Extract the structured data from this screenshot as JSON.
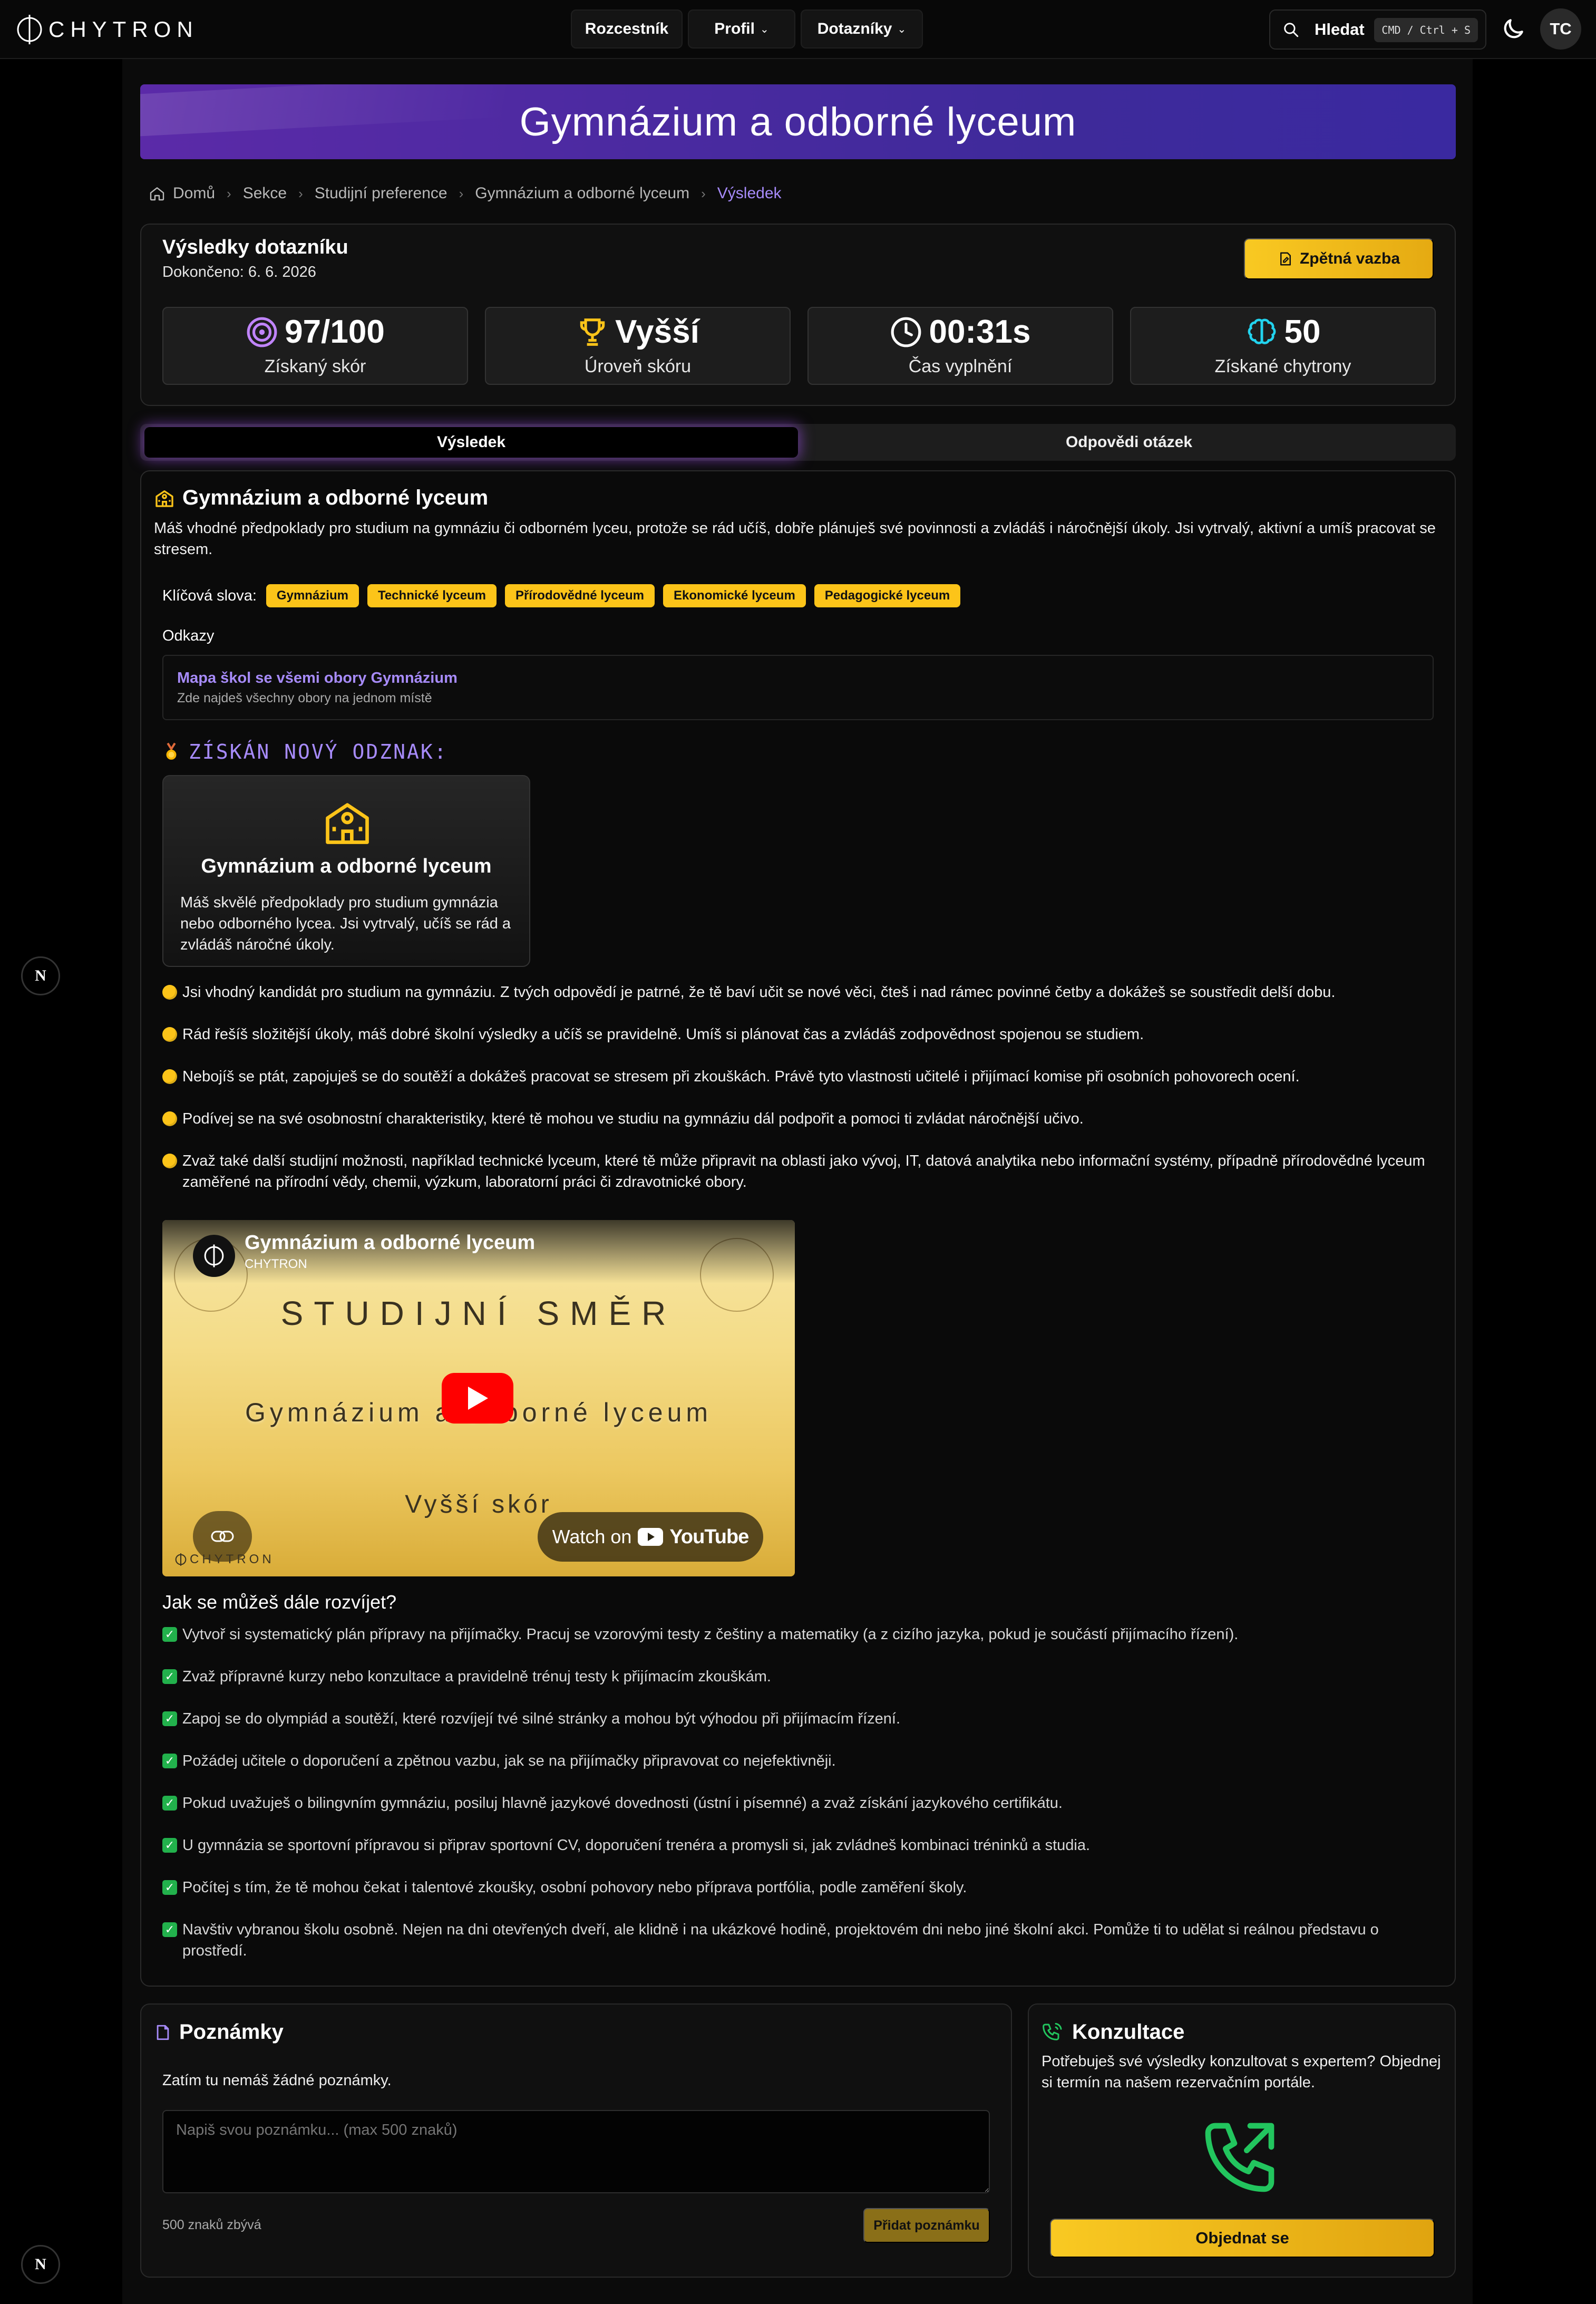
{
  "navbar": {
    "logo_text": "CHYTRON",
    "nav_items": [
      {
        "label": "Rozcestník",
        "has_dropdown": false
      },
      {
        "label": "Profil",
        "has_dropdown": true
      },
      {
        "label": "Dotazníky",
        "has_dropdown": true
      }
    ],
    "search_label": "Hledat",
    "search_shortcut": "CMD / Ctrl + S",
    "avatar_initials": "TC",
    "theme_icon": "moon-icon"
  },
  "hero": {
    "title": "Gymnázium a odborné lyceum"
  },
  "breadcrumb": [
    "Domů",
    "Sekce",
    "Studijní preference",
    "Gymnázium a odborné lyceum",
    "Výsledek"
  ],
  "result": {
    "title": "Výsledky dotazníku",
    "completed": "Dokončeno: 6. 6. 2026",
    "feedback_label": "Zpětná vazba",
    "stats": [
      {
        "value": "97/100",
        "label": "Získaný skór",
        "icon": "target-icon"
      },
      {
        "value": "Vyšší",
        "label": "Úroveň skóru",
        "icon": "trophy-icon"
      },
      {
        "value": "00:31s",
        "label": "Čas vyplnění",
        "icon": "clock-icon"
      },
      {
        "value": "50",
        "label": "Získané chytrony",
        "icon": "brain-icon"
      }
    ]
  },
  "tabs": [
    "Výsledek",
    "Odpovědi otázek"
  ],
  "content": {
    "title": "Gymnázium a odborné lyceum",
    "description": "Máš vhodné předpoklady pro studium na gymnáziu či odborném lyceu, protože se rád učíš, dobře plánuješ své povinnosti a zvládáš i náročnější úkoly. Jsi vytrvalý, aktivní a umíš pracovat se stresem.",
    "keywords_label": "Klíčová slova:",
    "keywords": [
      "Gymnázium",
      "Technické lyceum",
      "Přírodovědné lyceum",
      "Ekonomické lyceum",
      "Pedagogické lyceum"
    ],
    "links_label": "Odkazy",
    "link": {
      "title": "Mapa škol se všemi obory Gymnázium",
      "subtitle": "Zde najdeš všechny obory na jednom místě"
    },
    "badge_heading": "ZÍSKÁN NOVÝ ODZNAK:",
    "badge": {
      "title": "Gymnázium a odborné lyceum",
      "description": "Máš skvělé předpoklady pro studium gymnázia nebo odborného lycea. Jsi vytrvalý, učíš se rád a zvládáš náročné úkoly."
    },
    "bullets": [
      "Jsi vhodný kandidát pro studium na gymnáziu. Z tvých odpovědí je patrné, že tě baví učit se nové věci, čteš i nad rámec povinné četby a dokážeš se soustředit delší dobu.",
      "Rád řešíš složitější úkoly, máš dobré školní výsledky a učíš se pravidelně. Umíš si plánovat čas a zvládáš zodpovědnost spojenou se studiem.",
      "Nebojíš se ptát, zapojuješ se do soutěží a dokážeš pracovat se stresem při zkouškách. Právě tyto vlastnosti učitelé i přijímací komise při osobních pohovorech ocení.",
      "Podívej se na své osobnostní charakteristiky, které tě mohou ve studiu na gymnáziu dál podpořit a pomoci ti zvládat náročnější učivo.",
      "Zvaž také další studijní možnosti, například technické lyceum, které tě může připravit na oblasti jako vývoj, IT, datová analytika nebo informační systémy, případně přírodovědné lyceum zaměřené na přírodní vědy, chemii, výzkum, laboratorní práci či zdravotnické obory."
    ],
    "video": {
      "title": "Gymnázium a odborné lyceum",
      "channel": "CHYTRON",
      "line1": "STUDIJNÍ SMĚR",
      "line2": "Gymnázium a odborné lyceum",
      "line3": "Vyšší skór",
      "watch_prefix": "Watch on",
      "watch_brand": "YouTube",
      "logo": "CHYTRON"
    },
    "develop_heading": "Jak se můžeš dále rozvíjet?",
    "develop_items": [
      "Vytvoř si systematický plán přípravy na přijímačky. Pracuj se vzorovými testy z češtiny a matematiky (a z cizího jazyka, pokud je součástí přijímacího řízení).",
      "Zvaž přípravné kurzy nebo konzultace a pravidelně trénuj testy k přijímacím zkouškám.",
      "Zapoj se do olympiád a soutěží, které rozvíjejí tvé silné stránky a mohou být výhodou při přijímacím řízení.",
      "Požádej učitele o doporučení a zpětnou vazbu, jak se na přijímačky připravovat co nejefektivněji.",
      "Pokud uvažuješ o bilingvním gymnáziu, posiluj hlavně jazykové dovednosti (ústní i písemné) a zvaž získání jazykového certifikátu.",
      "U gymnázia se sportovní přípravou si připrav sportovní CV, doporučení trenéra a promysli si, jak zvládneš kombinaci tréninků a studia.",
      "Počítej s tím, že tě mohou čekat i talentové zkoušky, osobní pohovory nebo příprava portfólia, podle zaměření školy.",
      "Navštiv vybranou školu osobně. Nejen na dni otevřených dveří, ale klidně i na ukázkové hodině, projektovém dni nebo jiné školní akci. Pomůže ti to udělat si reálnou představu o prostředí."
    ]
  },
  "notes": {
    "title": "Poznámky",
    "empty": "Zatím tu nemáš žádné poznámky.",
    "placeholder": "Napiš svou poznámku... (max 500 znaků)",
    "remaining": "500 znaků zbývá",
    "add_label": "Přidat poznámku"
  },
  "consult": {
    "title": "Konzultace",
    "description": "Potřebuješ své výsledky konzultovat s expertem? Objednej si termín na našem rezervačním portále.",
    "button": "Objednat se"
  },
  "dev_badge": "N",
  "colors": {
    "accent_purple": "#a78bfa",
    "accent_yellow": "#fcc419",
    "check_green": "#22b14c"
  }
}
